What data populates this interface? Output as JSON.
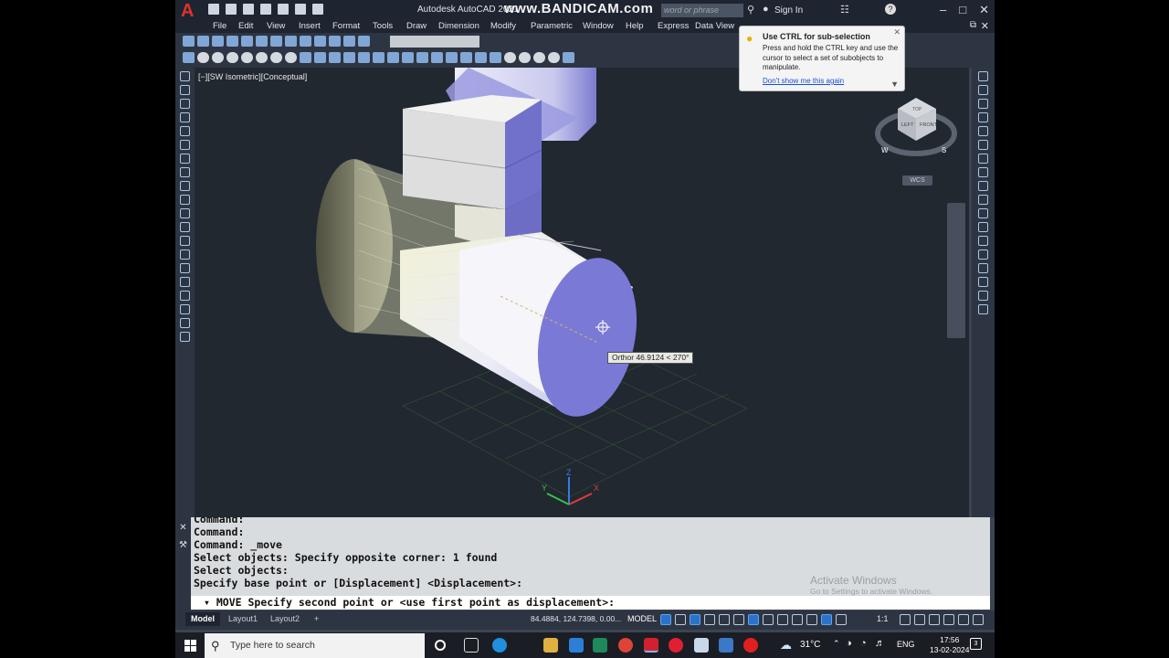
{
  "titlebar": {
    "app_title": "Autodesk AutoCAD 2021",
    "watermark": "www.BANDICAM.com",
    "search_placeholder": "word or phrase",
    "sign_in": "Sign In"
  },
  "menu": [
    "File",
    "Edit",
    "View",
    "Insert",
    "Format",
    "Tools",
    "Draw",
    "Dimension",
    "Modify",
    "Parametric",
    "Window",
    "Help",
    "Express",
    "Data View"
  ],
  "viewport": {
    "label": "[−][SW Isometric][Conceptual]",
    "ortho_tooltip": "Orthor 46.9124 < 270°",
    "viewcube": {
      "top": "TOP",
      "left": "LEFT",
      "front": "FRONT",
      "west": "W",
      "south": "S",
      "wcs": "WCS"
    },
    "ucs": {
      "x": "X",
      "y": "Y",
      "z": "Z"
    }
  },
  "balloon": {
    "title": "Use CTRL for sub-selection",
    "text": "Press and hold the CTRL key and use the cursor to select a set of subobjects to manipulate.",
    "link": "Don't show me this again"
  },
  "command": {
    "history": [
      "Command:",
      "Command:",
      "Command: _move",
      "Select objects: Specify opposite corner: 1 found",
      "Select objects:",
      "Specify base point or [Displacement] <Displacement>:"
    ],
    "prompt": "MOVE Specify second point or <use first point as displacement>:"
  },
  "activate_windows": {
    "title": "Activate Windows",
    "subtitle": "Go to Settings to activate Windows."
  },
  "statusbar": {
    "tabs": [
      "Model",
      "Layout1",
      "Layout2"
    ],
    "add_tab": "+",
    "coords": "84.4884, 124.7398, 0.00...",
    "model_label": "MODEL",
    "scale": "1:1"
  },
  "taskbar": {
    "search_placeholder": "Type here to search",
    "temperature": "31°C",
    "language": "ENG",
    "time": "17:56",
    "date": "13-02-2024",
    "notification_count": "3"
  },
  "colors": {
    "viewport_bg": "#212830",
    "chrome": "#2e3542",
    "accent": "#2a73c9"
  }
}
